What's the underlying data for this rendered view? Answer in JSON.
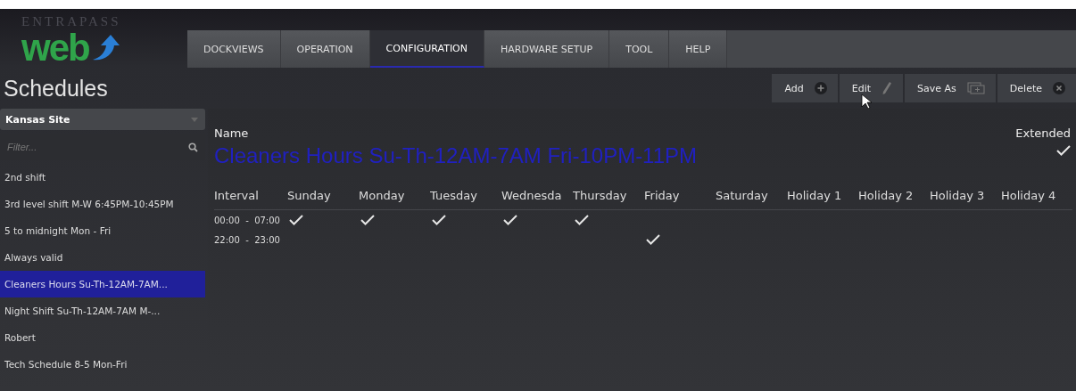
{
  "logo": {
    "brand": "ENTRAPASS",
    "word": "web"
  },
  "tabs": [
    {
      "label": "DOCKVIEWS",
      "selected": false
    },
    {
      "label": "OPERATION",
      "selected": false
    },
    {
      "label": "CONFIGURATION",
      "selected": true
    },
    {
      "label": "HARDWARE SETUP",
      "selected": false
    },
    {
      "label": "TOOL",
      "selected": false
    },
    {
      "label": "HELP",
      "selected": false
    }
  ],
  "page_title": "Schedules",
  "toolbar": [
    {
      "label": "Add",
      "kind": "add"
    },
    {
      "label": "Edit",
      "kind": "edit"
    },
    {
      "label": "Save As",
      "kind": "saveas"
    },
    {
      "label": "Delete",
      "kind": "delete"
    }
  ],
  "sidebar": {
    "site": "Kansas Site",
    "filter": {
      "placeholder": "Filter..."
    },
    "items": [
      {
        "label": "2nd shift",
        "selected": false
      },
      {
        "label": "3rd level shift  M-W 6:45PM-10:45PM",
        "selected": false
      },
      {
        "label": "5 to midnight Mon - Fri",
        "selected": false
      },
      {
        "label": "Always valid",
        "selected": false
      },
      {
        "label": "Cleaners Hours  Su-Th-12AM-7AM...",
        "selected": true
      },
      {
        "label": "Night Shift Su-Th-12AM-7AM  M-...",
        "selected": false
      },
      {
        "label": "Robert",
        "selected": false
      },
      {
        "label": "Tech Schedule 8-5  Mon-Fri",
        "selected": false
      }
    ]
  },
  "detail": {
    "name_label": "Name",
    "name": "Cleaners Hours  Su-Th-12AM-7AM  Fri-10PM-11PM",
    "extended_label": "Extended",
    "extended": true,
    "columns": [
      "Interval",
      "Sunday",
      "Monday",
      "Tuesday",
      "Wednesda",
      "Thursday",
      "Friday",
      "Saturday",
      "Holiday 1",
      "Holiday 2",
      "Holiday 3",
      "Holiday 4"
    ],
    "rows": [
      {
        "interval": "00:00  -  07:00",
        "days": [
          true,
          true,
          true,
          true,
          true,
          false,
          false,
          false,
          false,
          false,
          false
        ]
      },
      {
        "interval": "22:00  -  23:00",
        "days": [
          false,
          false,
          false,
          false,
          false,
          true,
          false,
          false,
          false,
          false,
          false
        ]
      }
    ]
  }
}
